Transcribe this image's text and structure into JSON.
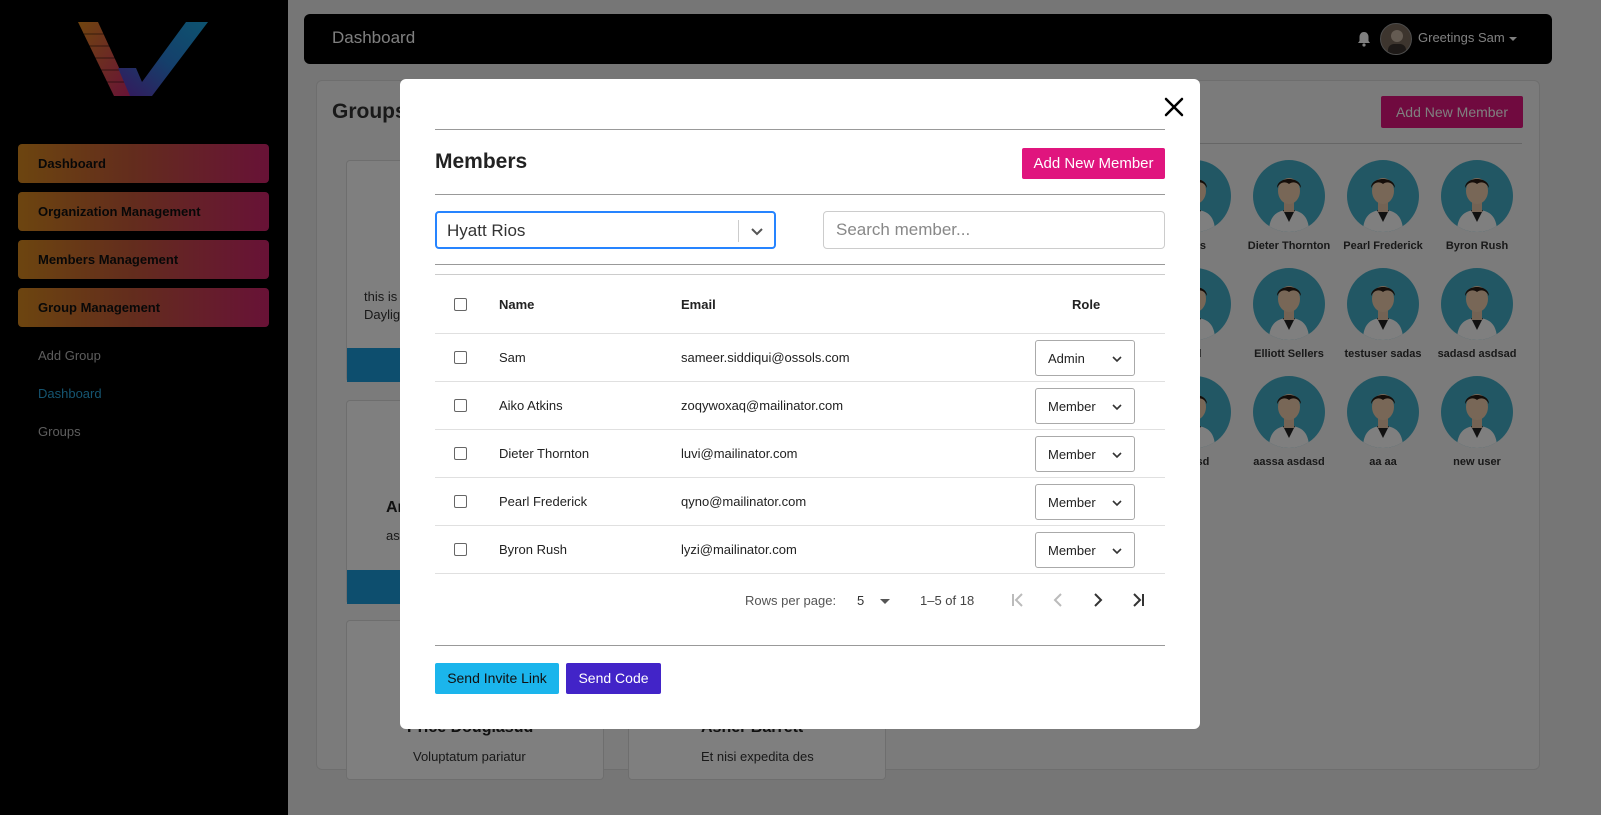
{
  "sidebar": {
    "nav": [
      {
        "label": "Dashboard"
      },
      {
        "label": "Organization Management"
      },
      {
        "label": "Members Management"
      },
      {
        "label": "Group Management"
      }
    ],
    "sub_links": [
      {
        "label": "Add Group"
      },
      {
        "label": "Dashboard"
      },
      {
        "label": "Groups"
      }
    ]
  },
  "header": {
    "title": "Dashboard",
    "greeting": "Greetings Sam"
  },
  "background": {
    "groups_title": "Groups",
    "add_member_label": "Add New Member",
    "group_cards": [
      {
        "text1": "this is",
        "text2": "Daylig"
      },
      {
        "name": "Ar",
        "text": "as"
      },
      {
        "name": "Price Douglasud",
        "text": "Voluptatum pariatur"
      },
      {
        "name": "Asher Barrett",
        "text": "Et nisi expedita des"
      }
    ],
    "member_tiles": [
      [
        "kins",
        "Dieter Thornton",
        "Pearl Frederick",
        "Byron Rush"
      ],
      [
        "ad",
        "Elliott Sellers",
        "testuser sadas",
        "sadasd asdsad"
      ],
      [
        "sd sd",
        "aassa asdasd",
        "aa aa",
        "new user"
      ]
    ]
  },
  "modal": {
    "title": "Members",
    "add_member_label": "Add New Member",
    "group_select": "Hyatt Rios",
    "search_placeholder": "Search member...",
    "columns": {
      "name": "Name",
      "email": "Email",
      "role": "Role"
    },
    "rows": [
      {
        "name": "Sam",
        "email": "sameer.siddiqui@ossols.com",
        "role": "Admin"
      },
      {
        "name": "Aiko Atkins",
        "email": "zoqywoxaq@mailinator.com",
        "role": "Member"
      },
      {
        "name": "Dieter Thornton",
        "email": "luvi@mailinator.com",
        "role": "Member"
      },
      {
        "name": "Pearl Frederick",
        "email": "qyno@mailinator.com",
        "role": "Member"
      },
      {
        "name": "Byron Rush",
        "email": "lyzi@mailinator.com",
        "role": "Member"
      }
    ],
    "pagination": {
      "rows_per_page_label": "Rows per page:",
      "rows_per_page": "5",
      "range": "1–5 of 18"
    },
    "send_invite_label": "Send Invite Link",
    "send_code_label": "Send Code"
  }
}
